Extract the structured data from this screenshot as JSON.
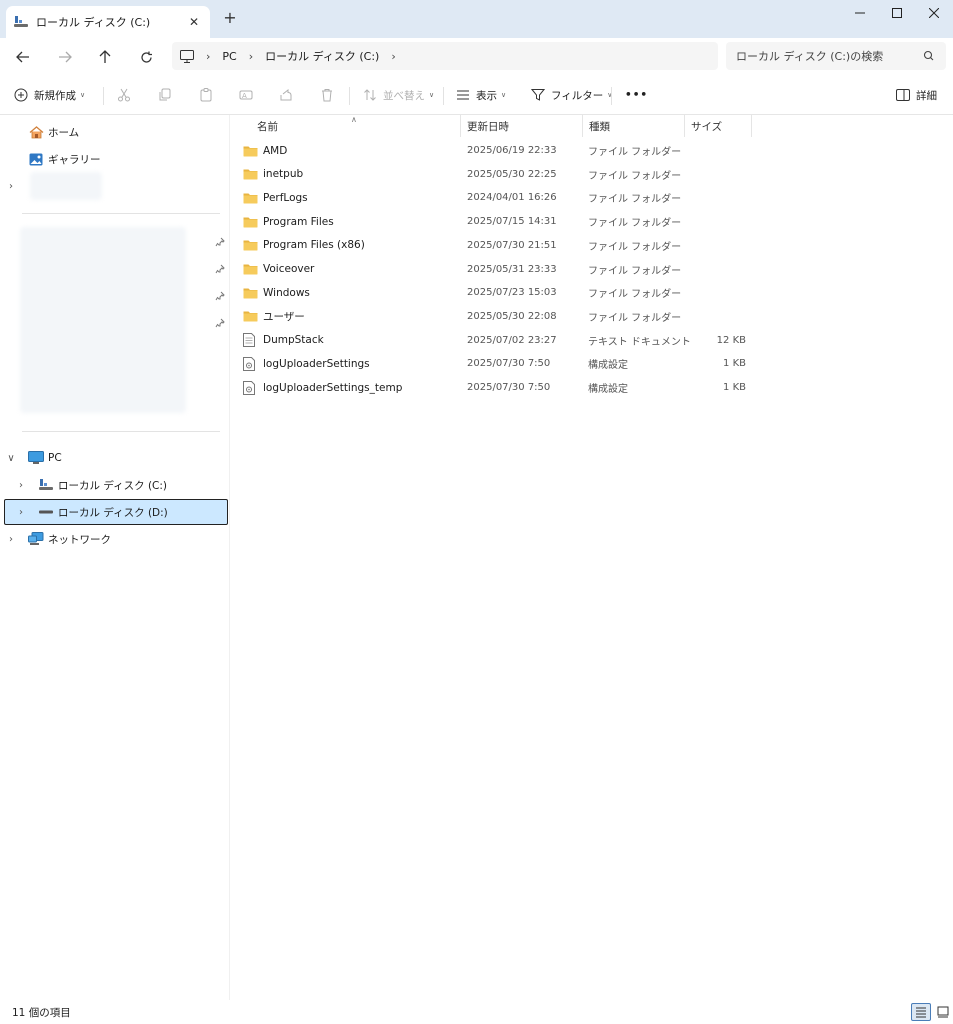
{
  "window": {
    "tab_title": "ローカル ディスク (C:)",
    "tab_close": "✕",
    "new_tab": "+"
  },
  "nav": {
    "breadcrumb": [
      "PC",
      "ローカル ディスク (C:)"
    ],
    "search_placeholder": "ローカル ディスク (C:)の検索"
  },
  "toolbar": {
    "new_label": "新規作成",
    "sort_label": "並べ替え",
    "view_label": "表示",
    "filter_label": "フィルター",
    "more_label": "•••",
    "details_label": "詳細"
  },
  "sidebar": {
    "home": "ホーム",
    "gallery": "ギャラリー",
    "pc": "PC",
    "local_c": "ローカル ディスク (C:)",
    "local_d": "ローカル ディスク (D:)",
    "network": "ネットワーク"
  },
  "columns": {
    "name": "名前",
    "date": "更新日時",
    "type": "種類",
    "size": "サイズ"
  },
  "files": [
    {
      "name": "AMD",
      "date": "2025/06/19 22:33",
      "type": "ファイル フォルダー",
      "size": "",
      "icon": "folder-icon"
    },
    {
      "name": "inetpub",
      "date": "2025/05/30 22:25",
      "type": "ファイル フォルダー",
      "size": "",
      "icon": "folder-icon"
    },
    {
      "name": "PerfLogs",
      "date": "2024/04/01 16:26",
      "type": "ファイル フォルダー",
      "size": "",
      "icon": "folder-icon"
    },
    {
      "name": "Program Files",
      "date": "2025/07/15 14:31",
      "type": "ファイル フォルダー",
      "size": "",
      "icon": "folder-icon"
    },
    {
      "name": "Program Files (x86)",
      "date": "2025/07/30 21:51",
      "type": "ファイル フォルダー",
      "size": "",
      "icon": "folder-icon"
    },
    {
      "name": "Voiceover",
      "date": "2025/05/31 23:33",
      "type": "ファイル フォルダー",
      "size": "",
      "icon": "folder-icon"
    },
    {
      "name": "Windows",
      "date": "2025/07/23 15:03",
      "type": "ファイル フォルダー",
      "size": "",
      "icon": "folder-icon"
    },
    {
      "name": "ユーザー",
      "date": "2025/05/30 22:08",
      "type": "ファイル フォルダー",
      "size": "",
      "icon": "folder-icon"
    },
    {
      "name": "DumpStack",
      "date": "2025/07/02 23:27",
      "type": "テキスト ドキュメント",
      "size": "12 KB",
      "icon": "text-file-icon"
    },
    {
      "name": "logUploaderSettings",
      "date": "2025/07/30 7:50",
      "type": "構成設定",
      "size": "1 KB",
      "icon": "config-file-icon"
    },
    {
      "name": "logUploaderSettings_temp",
      "date": "2025/07/30 7:50",
      "type": "構成設定",
      "size": "1 KB",
      "icon": "config-file-icon"
    }
  ],
  "status": {
    "item_count": "11 個の項目"
  },
  "colors": {
    "titlebar": "#dfe9f4",
    "selection": "#cce8ff",
    "folder": "#f2c75c"
  }
}
